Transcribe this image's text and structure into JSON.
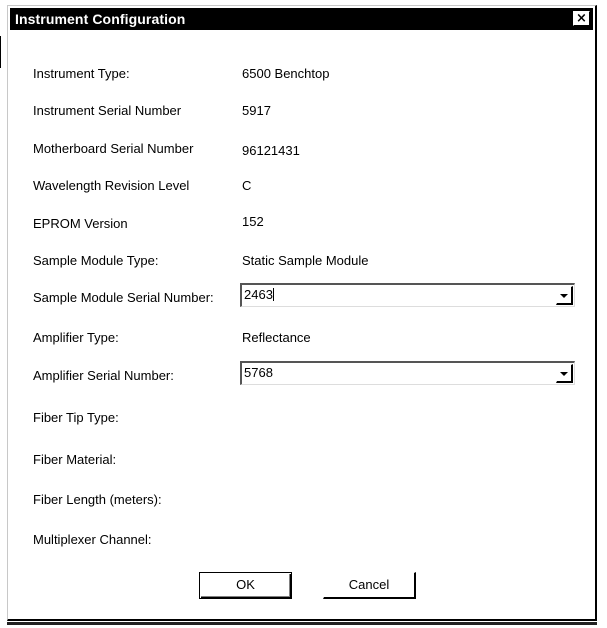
{
  "window": {
    "title": "Instrument Configuration",
    "close_glyph": "×"
  },
  "fields": [
    {
      "label": "Instrument Type:",
      "value": "6500 Benchtop"
    },
    {
      "label": "Instrument Serial Number",
      "value": "5917"
    },
    {
      "label": "Motherboard Serial Number",
      "value": "96121431"
    },
    {
      "label": "Wavelength Revision Level",
      "value": "C"
    },
    {
      "label": "EPROM Version",
      "value": "152"
    },
    {
      "label": "Sample Module Type:",
      "value": "Static Sample Module"
    },
    {
      "label": "Sample Module Serial Number:",
      "value": "2463"
    },
    {
      "label": "Amplifier Type:",
      "value": "Reflectance"
    },
    {
      "label": "Amplifier Serial Number:",
      "value": "5768"
    },
    {
      "label": "Fiber Tip Type:",
      "value": ""
    },
    {
      "label": "Fiber Material:",
      "value": ""
    },
    {
      "label": "Fiber Length (meters):",
      "value": ""
    },
    {
      "label": "Multiplexer Channel:",
      "value": ""
    }
  ],
  "buttons": {
    "ok": "OK",
    "cancel": "Cancel"
  }
}
